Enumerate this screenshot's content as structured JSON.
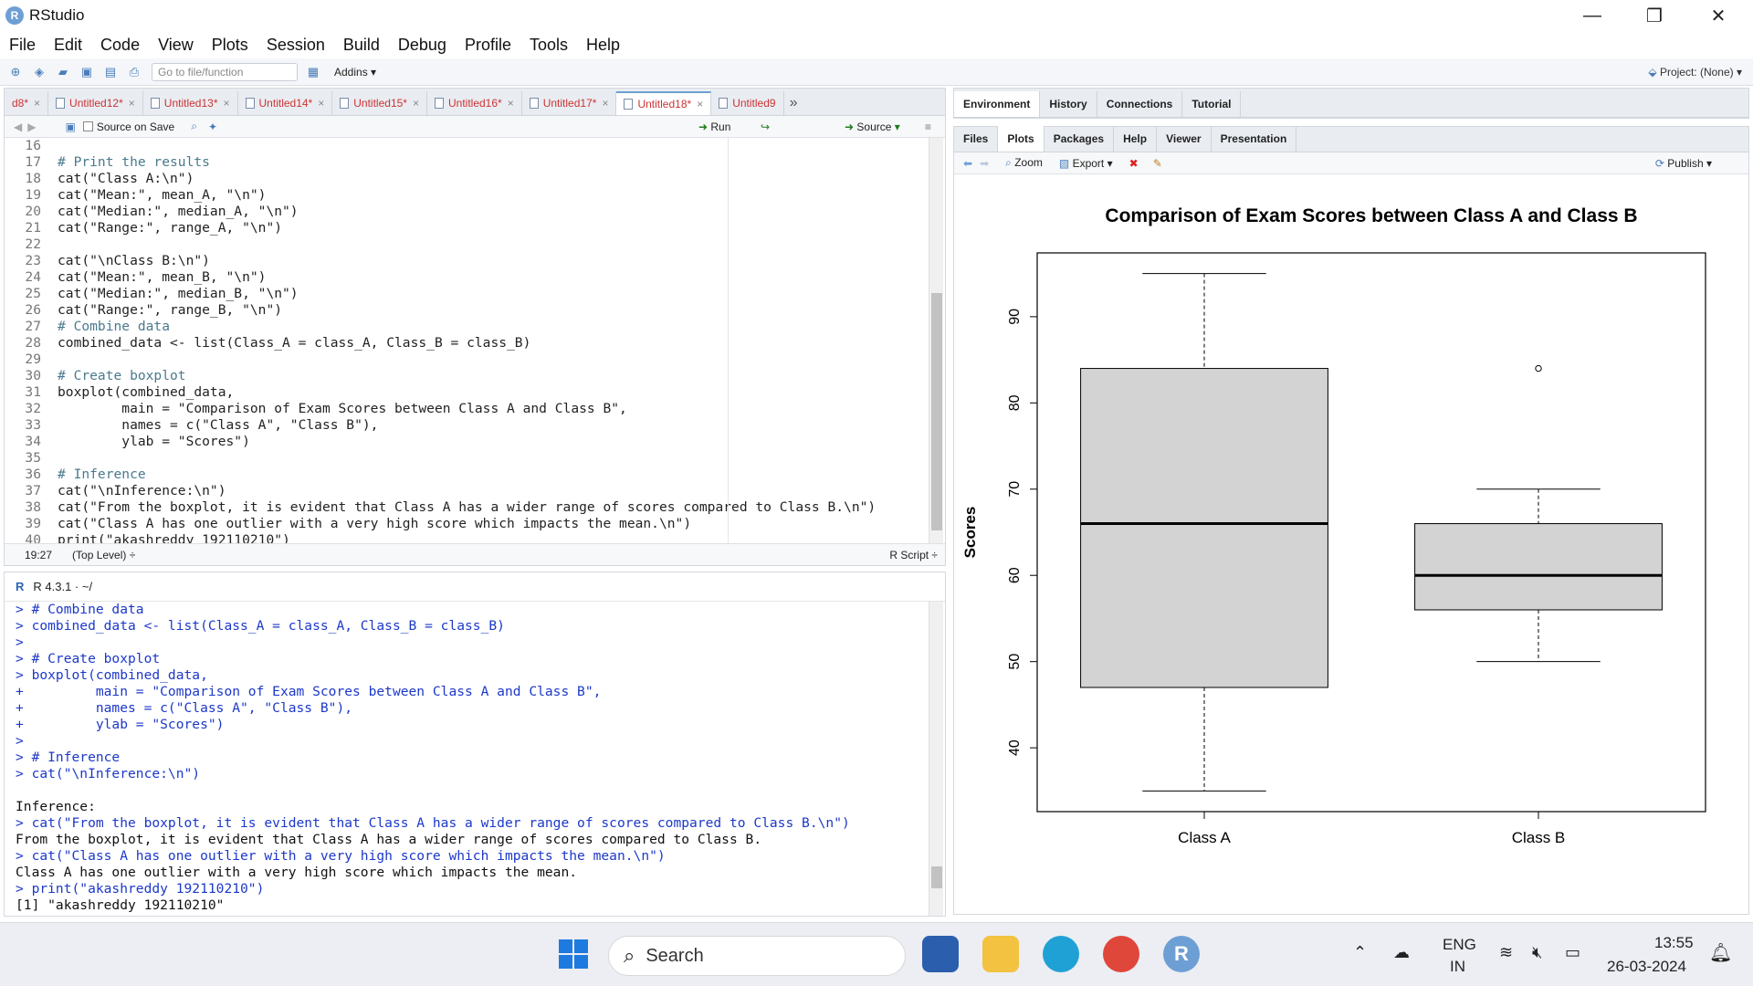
{
  "window": {
    "app_logo": "R",
    "title": "RStudio",
    "controls": {
      "minimize": "—",
      "restore": "❐",
      "close": "✕"
    }
  },
  "menu": [
    "File",
    "Edit",
    "Code",
    "View",
    "Plots",
    "Session",
    "Build",
    "Debug",
    "Profile",
    "Tools",
    "Help"
  ],
  "toolbar": {
    "goto_placeholder": "Go to file/function",
    "addins_label": "Addins",
    "project_label": "Project: (None)"
  },
  "source_tabs": [
    {
      "label": "d8*",
      "active": false
    },
    {
      "label": "Untitled12*",
      "active": false
    },
    {
      "label": "Untitled13*",
      "active": false
    },
    {
      "label": "Untitled14*",
      "active": false
    },
    {
      "label": "Untitled15*",
      "active": false
    },
    {
      "label": "Untitled16*",
      "active": false
    },
    {
      "label": "Untitled17*",
      "active": false
    },
    {
      "label": "Untitled18*",
      "active": true
    },
    {
      "label": "Untitled9",
      "active": false
    }
  ],
  "editor_toolbar": {
    "source_on_save": "Source on Save",
    "run_label": "Run",
    "source_label": "Source"
  },
  "editor": {
    "lines": [
      {
        "n": "16",
        "t": "",
        "c": ""
      },
      {
        "n": "17",
        "t": "# Print the results",
        "c": "cmt"
      },
      {
        "n": "18",
        "t": "cat(\"Class A:\\n\")",
        "c": ""
      },
      {
        "n": "19",
        "t": "cat(\"Mean:\", mean_A, \"\\n\")",
        "c": ""
      },
      {
        "n": "20",
        "t": "cat(\"Median:\", median_A, \"\\n\")",
        "c": ""
      },
      {
        "n": "21",
        "t": "cat(\"Range:\", range_A, \"\\n\")",
        "c": ""
      },
      {
        "n": "22",
        "t": "",
        "c": ""
      },
      {
        "n": "23",
        "t": "cat(\"\\nClass B:\\n\")",
        "c": ""
      },
      {
        "n": "24",
        "t": "cat(\"Mean:\", mean_B, \"\\n\")",
        "c": ""
      },
      {
        "n": "25",
        "t": "cat(\"Median:\", median_B, \"\\n\")",
        "c": ""
      },
      {
        "n": "26",
        "t": "cat(\"Range:\", range_B, \"\\n\")",
        "c": ""
      },
      {
        "n": "27",
        "t": "# Combine data",
        "c": "cmt"
      },
      {
        "n": "28",
        "t": "combined_data <- list(Class_A = class_A, Class_B = class_B)",
        "c": ""
      },
      {
        "n": "29",
        "t": "",
        "c": ""
      },
      {
        "n": "30",
        "t": "# Create boxplot",
        "c": "cmt"
      },
      {
        "n": "31",
        "t": "boxplot(combined_data,",
        "c": ""
      },
      {
        "n": "32",
        "t": "        main = \"Comparison of Exam Scores between Class A and Class B\",",
        "c": ""
      },
      {
        "n": "33",
        "t": "        names = c(\"Class A\", \"Class B\"),",
        "c": ""
      },
      {
        "n": "34",
        "t": "        ylab = \"Scores\")",
        "c": ""
      },
      {
        "n": "35",
        "t": "",
        "c": ""
      },
      {
        "n": "36",
        "t": "# Inference",
        "c": "cmt"
      },
      {
        "n": "37",
        "t": "cat(\"\\nInference:\\n\")",
        "c": ""
      },
      {
        "n": "38",
        "t": "cat(\"From the boxplot, it is evident that Class A has a wider range of scores compared to Class B.\\n\")",
        "c": ""
      },
      {
        "n": "39",
        "t": "cat(\"Class A has one outlier with a very high score which impacts the mean.\\n\")",
        "c": ""
      },
      {
        "n": "40",
        "t": "print(\"akashreddy 192110210\")",
        "c": ""
      }
    ],
    "status_pos": "19:27",
    "status_scope": "(Top Level) ÷",
    "status_type": "R Script ÷"
  },
  "console": {
    "header": "R 4.3.1 · ~/",
    "lines": [
      {
        "t": "> # Combine data",
        "c": "blue"
      },
      {
        "t": "> combined_data <- list(Class_A = class_A, Class_B = class_B)",
        "c": "blue"
      },
      {
        "t": ">",
        "c": "blue"
      },
      {
        "t": "> # Create boxplot",
        "c": "blue"
      },
      {
        "t": "> boxplot(combined_data,",
        "c": "blue"
      },
      {
        "t": "+         main = \"Comparison of Exam Scores between Class A and Class B\",",
        "c": "blue"
      },
      {
        "t": "+         names = c(\"Class A\", \"Class B\"),",
        "c": "blue"
      },
      {
        "t": "+         ylab = \"Scores\")",
        "c": "blue"
      },
      {
        "t": ">",
        "c": "blue"
      },
      {
        "t": "> # Inference",
        "c": "blue"
      },
      {
        "t": "> cat(\"\\nInference:\\n\")",
        "c": "blue"
      },
      {
        "t": "",
        "c": "black"
      },
      {
        "t": "Inference:",
        "c": "black"
      },
      {
        "t": "> cat(\"From the boxplot, it is evident that Class A has a wider range of scores compared to Class B.\\n\")",
        "c": "blue"
      },
      {
        "t": "From the boxplot, it is evident that Class A has a wider range of scores compared to Class B.",
        "c": "black"
      },
      {
        "t": "> cat(\"Class A has one outlier with a very high score which impacts the mean.\\n\")",
        "c": "blue"
      },
      {
        "t": "Class A has one outlier with a very high score which impacts the mean.",
        "c": "black"
      },
      {
        "t": "> print(\"akashreddy 192110210\")",
        "c": "blue"
      },
      {
        "t": "[1] \"akashreddy 192110210\"",
        "c": "black"
      }
    ]
  },
  "right_top_tabs": [
    "Environment",
    "History",
    "Connections",
    "Tutorial"
  ],
  "right_bottom_tabs": [
    "Files",
    "Plots",
    "Packages",
    "Help",
    "Viewer",
    "Presentation"
  ],
  "plot_toolbar": {
    "zoom": "Zoom",
    "export": "Export",
    "publish": "Publish"
  },
  "chart_data": {
    "type": "boxplot",
    "title": "Comparison of Exam Scores between Class A and Class B",
    "xlabel": "",
    "ylabel": "Scores",
    "ylim": [
      32.6,
      97.4
    ],
    "yticks": [
      40,
      50,
      60,
      70,
      80,
      90
    ],
    "categories": [
      "Class A",
      "Class B"
    ],
    "boxes": [
      {
        "name": "Class A",
        "min": 35,
        "q1": 47,
        "median": 66,
        "q3": 84,
        "max": 95,
        "outliers": []
      },
      {
        "name": "Class B",
        "min": 50,
        "q1": 56,
        "median": 60,
        "q3": 66,
        "max": 70,
        "outliers": [
          84
        ]
      }
    ],
    "box_color": "#d3d3d3"
  },
  "taskbar": {
    "search_label": "Search",
    "lang_top": "ENG",
    "lang_bottom": "IN",
    "time": "13:55",
    "date": "26-03-2024"
  }
}
